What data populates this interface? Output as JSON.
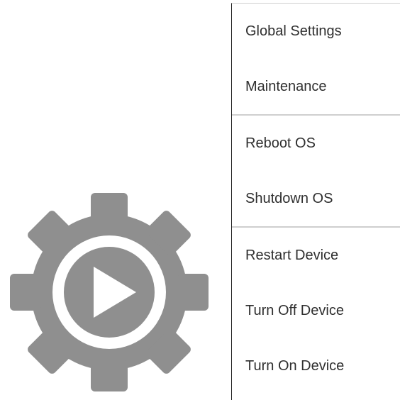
{
  "menu": {
    "items": [
      {
        "label": "Global Settings"
      },
      {
        "label": "Maintenance"
      },
      {
        "label": "Reboot OS"
      },
      {
        "label": "Shutdown OS"
      },
      {
        "label": "Restart Device"
      },
      {
        "label": "Turn Off Device"
      },
      {
        "label": "Turn On Device"
      }
    ]
  },
  "colors": {
    "gear": "#8f8f8f",
    "text": "#2f2f2f",
    "divider": "#cfcfcf",
    "background": "#ffffff"
  },
  "icons": {
    "gear": "gear-play-icon"
  }
}
